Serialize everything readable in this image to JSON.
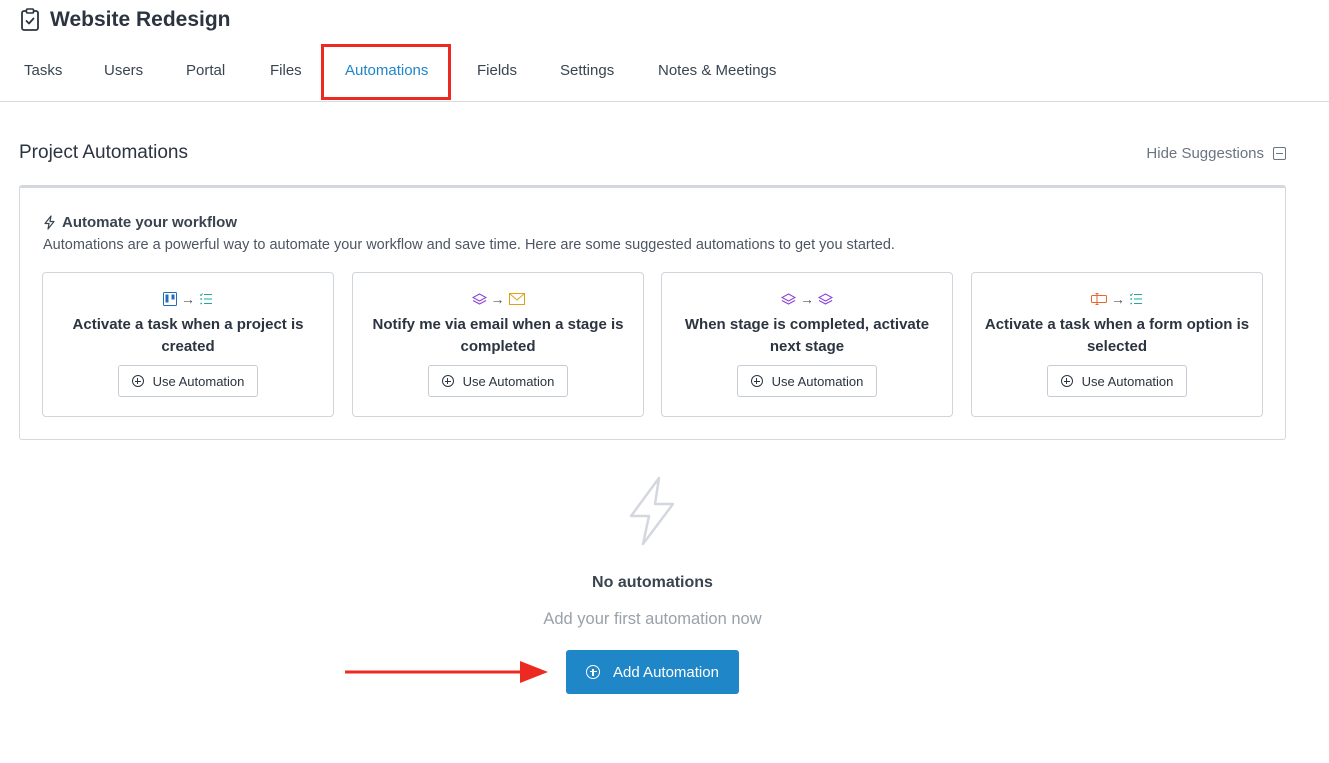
{
  "project": {
    "title": "Website Redesign",
    "icon": "clipboard-check-icon"
  },
  "tabs": [
    {
      "label": "Tasks",
      "active": false
    },
    {
      "label": "Users",
      "active": false
    },
    {
      "label": "Portal",
      "active": false
    },
    {
      "label": "Files",
      "active": false
    },
    {
      "label": "Automations",
      "active": true
    },
    {
      "label": "Fields",
      "active": false
    },
    {
      "label": "Settings",
      "active": false
    },
    {
      "label": "Notes & Meetings",
      "active": false
    }
  ],
  "section": {
    "title": "Project Automations",
    "hide_suggestions_label": "Hide Suggestions"
  },
  "suggestions": {
    "heading": "Automate your workflow",
    "description": "Automations are a powerful way to automate your workflow and save time. Here are some suggested automations to get you started.",
    "button_label": "Use Automation",
    "cards": [
      {
        "title": "Activate a task when a project is created",
        "from_icon": "kanban-board-icon",
        "to_icon": "task-list-icon"
      },
      {
        "title": "Notify me via email when a stage is completed",
        "from_icon": "stage-layers-icon",
        "to_icon": "envelope-icon"
      },
      {
        "title": "When stage is completed, activate next stage",
        "from_icon": "stage-layers-icon",
        "to_icon": "stage-layers-icon"
      },
      {
        "title": "Activate a task when a form option is selected",
        "from_icon": "form-option-icon",
        "to_icon": "task-list-icon"
      }
    ]
  },
  "empty_state": {
    "icon": "lightning-bolt-icon",
    "title": "No automations",
    "subtitle": "Add your first automation now",
    "button_label": "Add Automation"
  },
  "colors": {
    "accent": "#1f86c8",
    "highlight": "#ec2a22",
    "stage_icon": "#8a3fd9",
    "email_icon": "#e0a11b",
    "list_icon": "#1ea89a",
    "form_icon": "#e8662a"
  }
}
